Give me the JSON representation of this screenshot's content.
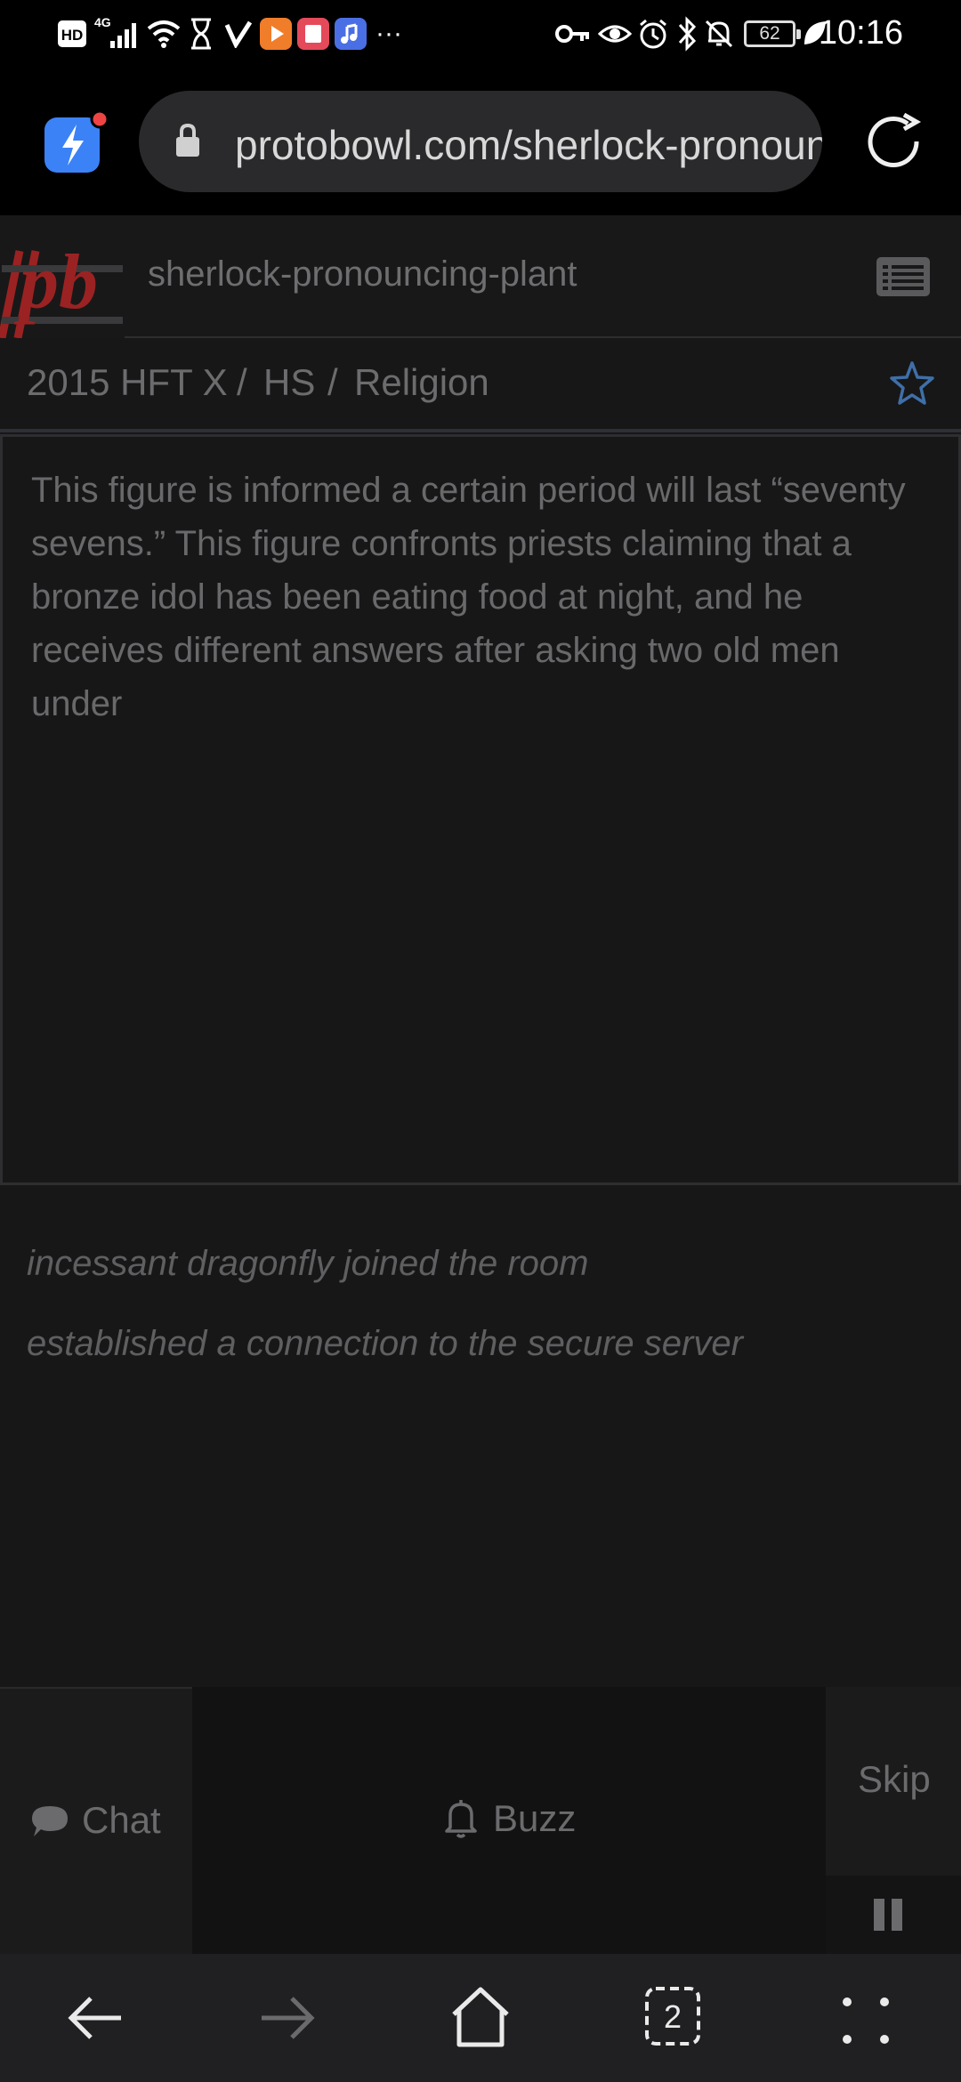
{
  "status_bar": {
    "left_icons": [
      "hd-icon",
      "4g-signal-icon",
      "wifi-icon",
      "hourglass-icon",
      "v-app-icon",
      "play-app-icon",
      "book-app-icon",
      "music-app-icon",
      "more-dots-icon"
    ],
    "hd_label": "HD",
    "net_label": "4G",
    "more_label": "···",
    "battery_level": "62",
    "time": "10:16"
  },
  "browser": {
    "url": "protobowl.com/sherlock-pronouncing-plant"
  },
  "app_header": {
    "logo_text": "pb",
    "room_name": "sherlock-pronouncing-plant"
  },
  "breadcrumb": {
    "items": [
      "2015 HFT X",
      "HS",
      "Religion"
    ],
    "separator": "/"
  },
  "question": {
    "text": "This figure is informed a certain period will last “seventy sevens.” This figure confronts priests claiming that a bronze idol has been eating food at night, and he receives different answers after asking two old men under"
  },
  "log": [
    "incessant dragonfly joined the room",
    "established a connection to the secure server"
  ],
  "actions": {
    "chat": "Chat",
    "buzz": "Buzz",
    "skip": "Skip"
  },
  "nav": {
    "tab_count": "2"
  },
  "colors": {
    "background": "#171718",
    "text_muted": "#69696b",
    "star_blue": "#3f6fa8",
    "logo_red": "#9b2222"
  }
}
